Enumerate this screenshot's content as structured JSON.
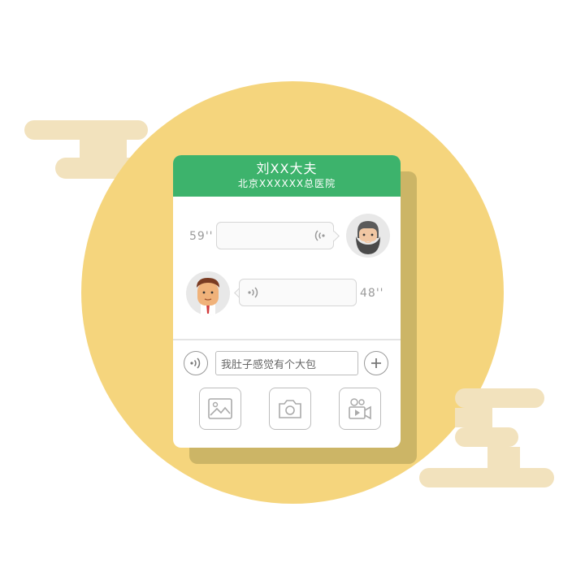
{
  "colors": {
    "header_green": "#3db36c",
    "circle_yellow": "#f5d57d",
    "cloud": "#f2e2bd",
    "card_shadow": "#ccb566"
  },
  "header": {
    "doctor": "刘XX大夫",
    "hospital": "北京XXXXXX总医院"
  },
  "messages": [
    {
      "side": "right",
      "duration": "59''",
      "avatar": "bearded-man-avatar",
      "icon": "voice-wave-icon"
    },
    {
      "side": "left",
      "duration": "48''",
      "avatar": "young-man-avatar",
      "icon": "voice-wave-icon"
    }
  ],
  "composer": {
    "text": "我肚子感觉有个大包",
    "voice_icon": "voice-wave-icon",
    "add_icon": "plus-icon"
  },
  "tools": [
    {
      "name": "image-icon"
    },
    {
      "name": "camera-icon"
    },
    {
      "name": "video-camera-icon"
    }
  ]
}
